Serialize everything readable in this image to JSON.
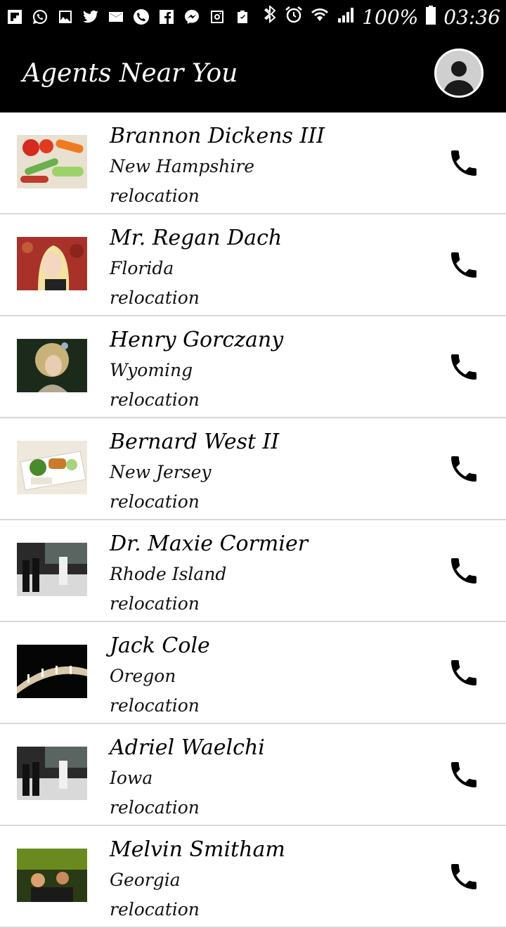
{
  "statusbar": {
    "battery": "100%",
    "time": "03:36",
    "left_icons": [
      "flipboard-icon",
      "whatsapp-icon",
      "gallery-icon",
      "twitter-icon",
      "email-icon",
      "phone-icon",
      "facebook-icon",
      "messenger-icon",
      "instagram-icon",
      "clipboard-icon"
    ],
    "right_icons": [
      "bluetooth-icon",
      "alarm-icon",
      "wifi-icon",
      "signal-icon",
      "battery-icon"
    ]
  },
  "appbar": {
    "title": "Agents Near You",
    "avatar_icon": "profile-avatar-icon"
  },
  "agents": [
    {
      "name": "Brannon Dickens III",
      "state": "New Hampshire",
      "reason": "relocation",
      "thumb": "vegetables-photo"
    },
    {
      "name": "Mr. Regan Dach",
      "state": "Florida",
      "reason": "relocation",
      "thumb": "blonde-woman-photo"
    },
    {
      "name": "Henry Gorczany",
      "state": "Wyoming",
      "reason": "relocation",
      "thumb": "girl-with-flowers-photo"
    },
    {
      "name": "Bernard West II",
      "state": "New Jersey",
      "reason": "relocation",
      "thumb": "food-tray-photo"
    },
    {
      "name": "Dr. Maxie Cormier",
      "state": "Rhode Island",
      "reason": "relocation",
      "thumb": "kitchen-photo"
    },
    {
      "name": "Jack Cole",
      "state": "Oregon",
      "reason": "relocation",
      "thumb": "runway-photo"
    },
    {
      "name": "Adriel Waelchi",
      "state": "Iowa",
      "reason": "relocation",
      "thumb": "kitchen-photo"
    },
    {
      "name": "Melvin Smitham",
      "state": "Georgia",
      "reason": "relocation",
      "thumb": "bar-crowd-photo"
    }
  ],
  "colors": {
    "appbar": "#000000",
    "divider": "#d8d8d8"
  }
}
